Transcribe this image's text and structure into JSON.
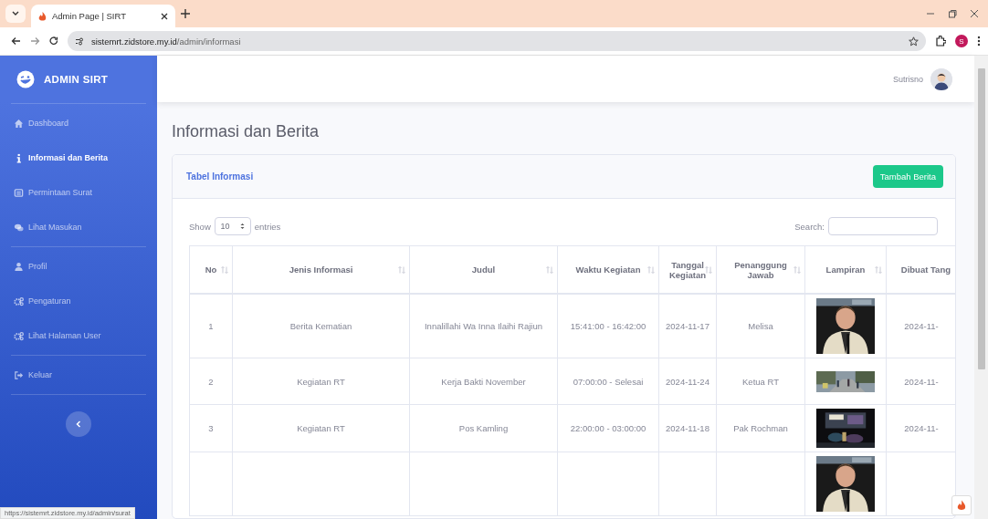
{
  "browser": {
    "tab_title": "Admin Page | SIRT",
    "url_host": "sistemrt.zidstore.my.id",
    "url_path": "/admin/informasi",
    "profile_letter": "S"
  },
  "sidebar": {
    "brand": "ADMIN SIRT",
    "sections": [
      [
        {
          "label": "Dashboard",
          "selected": false
        },
        {
          "label": "Informasi dan Berita",
          "selected": true
        },
        {
          "label": "Permintaan Surat",
          "selected": false
        },
        {
          "label": "Lihat Masukan",
          "selected": false
        }
      ],
      [
        {
          "label": "Profil",
          "selected": false
        },
        {
          "label": "Pengaturan",
          "selected": false
        },
        {
          "label": "Lihat Halaman User",
          "selected": false
        }
      ],
      [
        {
          "label": "Keluar",
          "selected": false
        }
      ]
    ]
  },
  "topbar": {
    "user_name": "Sutrisno"
  },
  "page_title": "Informasi dan Berita",
  "card": {
    "title": "Tabel Informasi",
    "add_button": "Tambah Berita"
  },
  "table_controls": {
    "show_label": "Show",
    "page_size": "10",
    "entries_label": "entries",
    "search_label": "Search:"
  },
  "table": {
    "columns": [
      "No",
      "Jenis Informasi",
      "Judul",
      "Waktu Kegiatan",
      "Tanggal Kegiatan",
      "Penanggung Jawab",
      "Lampiran",
      "Dibuat Tang"
    ],
    "rows": [
      {
        "no": "1",
        "jenis": "Berita Kematian",
        "judul": "Innalillahi Wa Inna Ilaihi Rajiun",
        "waktu": "15:41:00 - 16:42:00",
        "tanggal": "2024-11-17",
        "penanggung": "Melisa",
        "lampiran": {
          "kind": "picture"
        },
        "dibuat": "2024-11-"
      },
      {
        "no": "2",
        "jenis": "Kegiatan RT",
        "judul": "Kerja Bakti November",
        "waktu": "07:00:00 - Selesai",
        "tanggal": "2024-11-24",
        "penanggung": "Ketua RT",
        "lampiran": {
          "kind": "picture"
        },
        "dibuat": "2024-11-"
      },
      {
        "no": "3",
        "jenis": "Kegiatan RT",
        "judul": "Pos Kamling",
        "waktu": "22:00:00 - 03:00:00",
        "tanggal": "2024-11-18",
        "penanggung": "Pak Rochman",
        "lampiran": {
          "kind": "picture"
        },
        "dibuat": "2024-11-"
      },
      {
        "lampiran": {
          "kind": "picture"
        }
      }
    ]
  },
  "status_bar": {
    "url": "https://sistemrt.zidstore.my.id/admin/surat"
  }
}
